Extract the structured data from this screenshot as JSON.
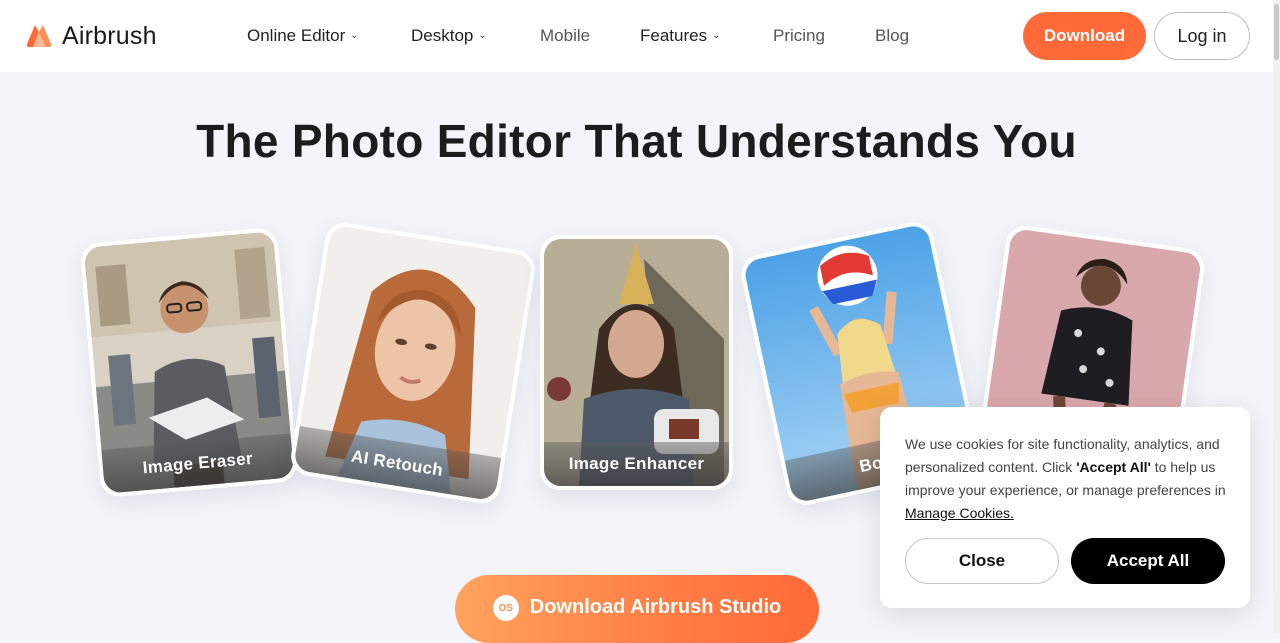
{
  "brand": {
    "name": "Airbrush",
    "accent_color": "#ff6a38"
  },
  "nav": {
    "items": [
      {
        "label": "Online Editor",
        "has_dropdown": true
      },
      {
        "label": "Desktop",
        "has_dropdown": true
      },
      {
        "label": "Mobile",
        "has_dropdown": false
      },
      {
        "label": "Features",
        "has_dropdown": true
      },
      {
        "label": "Pricing",
        "has_dropdown": false
      },
      {
        "label": "Blog",
        "has_dropdown": false
      }
    ],
    "download_label": "Download",
    "login_label": "Log in"
  },
  "hero": {
    "title": "The Photo Editor That Understands You"
  },
  "cards": [
    {
      "label": "Image Eraser",
      "photo": "man-in-street-photo"
    },
    {
      "label": "AI Retouch",
      "photo": "woman-portrait-photo"
    },
    {
      "label": "Image Enhancer",
      "photo": "girl-party-hat-photo"
    },
    {
      "label": "Body",
      "photo": "woman-beach-ball-photo"
    },
    {
      "label": "",
      "photo": "woman-pink-backdrop-photo"
    }
  ],
  "cookie_banner": {
    "text_before": "We use cookies for site functionality, analytics, and personalized content. Click ",
    "accept_quote": "'Accept All'",
    "text_after": " to help us improve your experience, or manage preferences in ",
    "manage_link": "Manage Cookies.",
    "close_label": "Close",
    "accept_label": "Accept All"
  },
  "cta": {
    "label": "Download Airbrush Studio",
    "icon_text": "OS"
  }
}
